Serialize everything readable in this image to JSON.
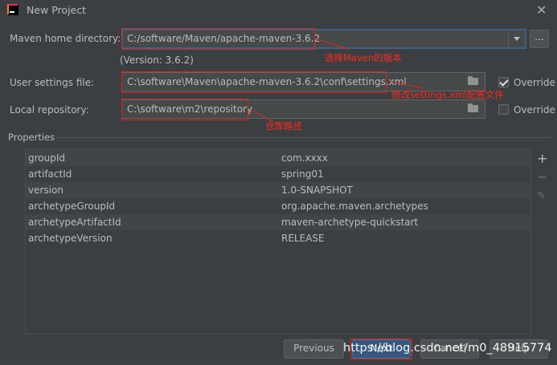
{
  "window": {
    "title": "New Project"
  },
  "maven_home": {
    "label": "Maven home directory:",
    "value": "C:/software/Maven/apache-maven-3.6.2",
    "version": "(Version: 3.6.2)",
    "browse_label": "..."
  },
  "user_settings": {
    "label": "User settings file:",
    "value": "C:\\software\\Maven\\apache-maven-3.6.2\\conf\\settings.xml",
    "override_label": "Override",
    "override_checked": true
  },
  "local_repo": {
    "label": "Local repository:",
    "value": "C:\\software\\m2\\repository",
    "override_label": "Override",
    "override_checked": false
  },
  "annotations": {
    "maven_version": "选择Maven的版本",
    "settings": "修改settings.xml配置文件",
    "repository": "仓库路径"
  },
  "properties": {
    "section_label": "Properties",
    "rows": [
      {
        "key": "groupId",
        "value": "com.xxxx"
      },
      {
        "key": "artifactId",
        "value": "spring01"
      },
      {
        "key": "version",
        "value": "1.0-SNAPSHOT"
      },
      {
        "key": "archetypeGroupId",
        "value": "org.apache.maven.archetypes"
      },
      {
        "key": "archetypeArtifactId",
        "value": "maven-archetype-quickstart"
      },
      {
        "key": "archetypeVersion",
        "value": "RELEASE"
      }
    ]
  },
  "buttons": {
    "previous": "Previous",
    "next": "Next",
    "cancel": "Cancel",
    "help": "Help"
  },
  "watermark": "https://blog.csdn.net/m0_48915774"
}
